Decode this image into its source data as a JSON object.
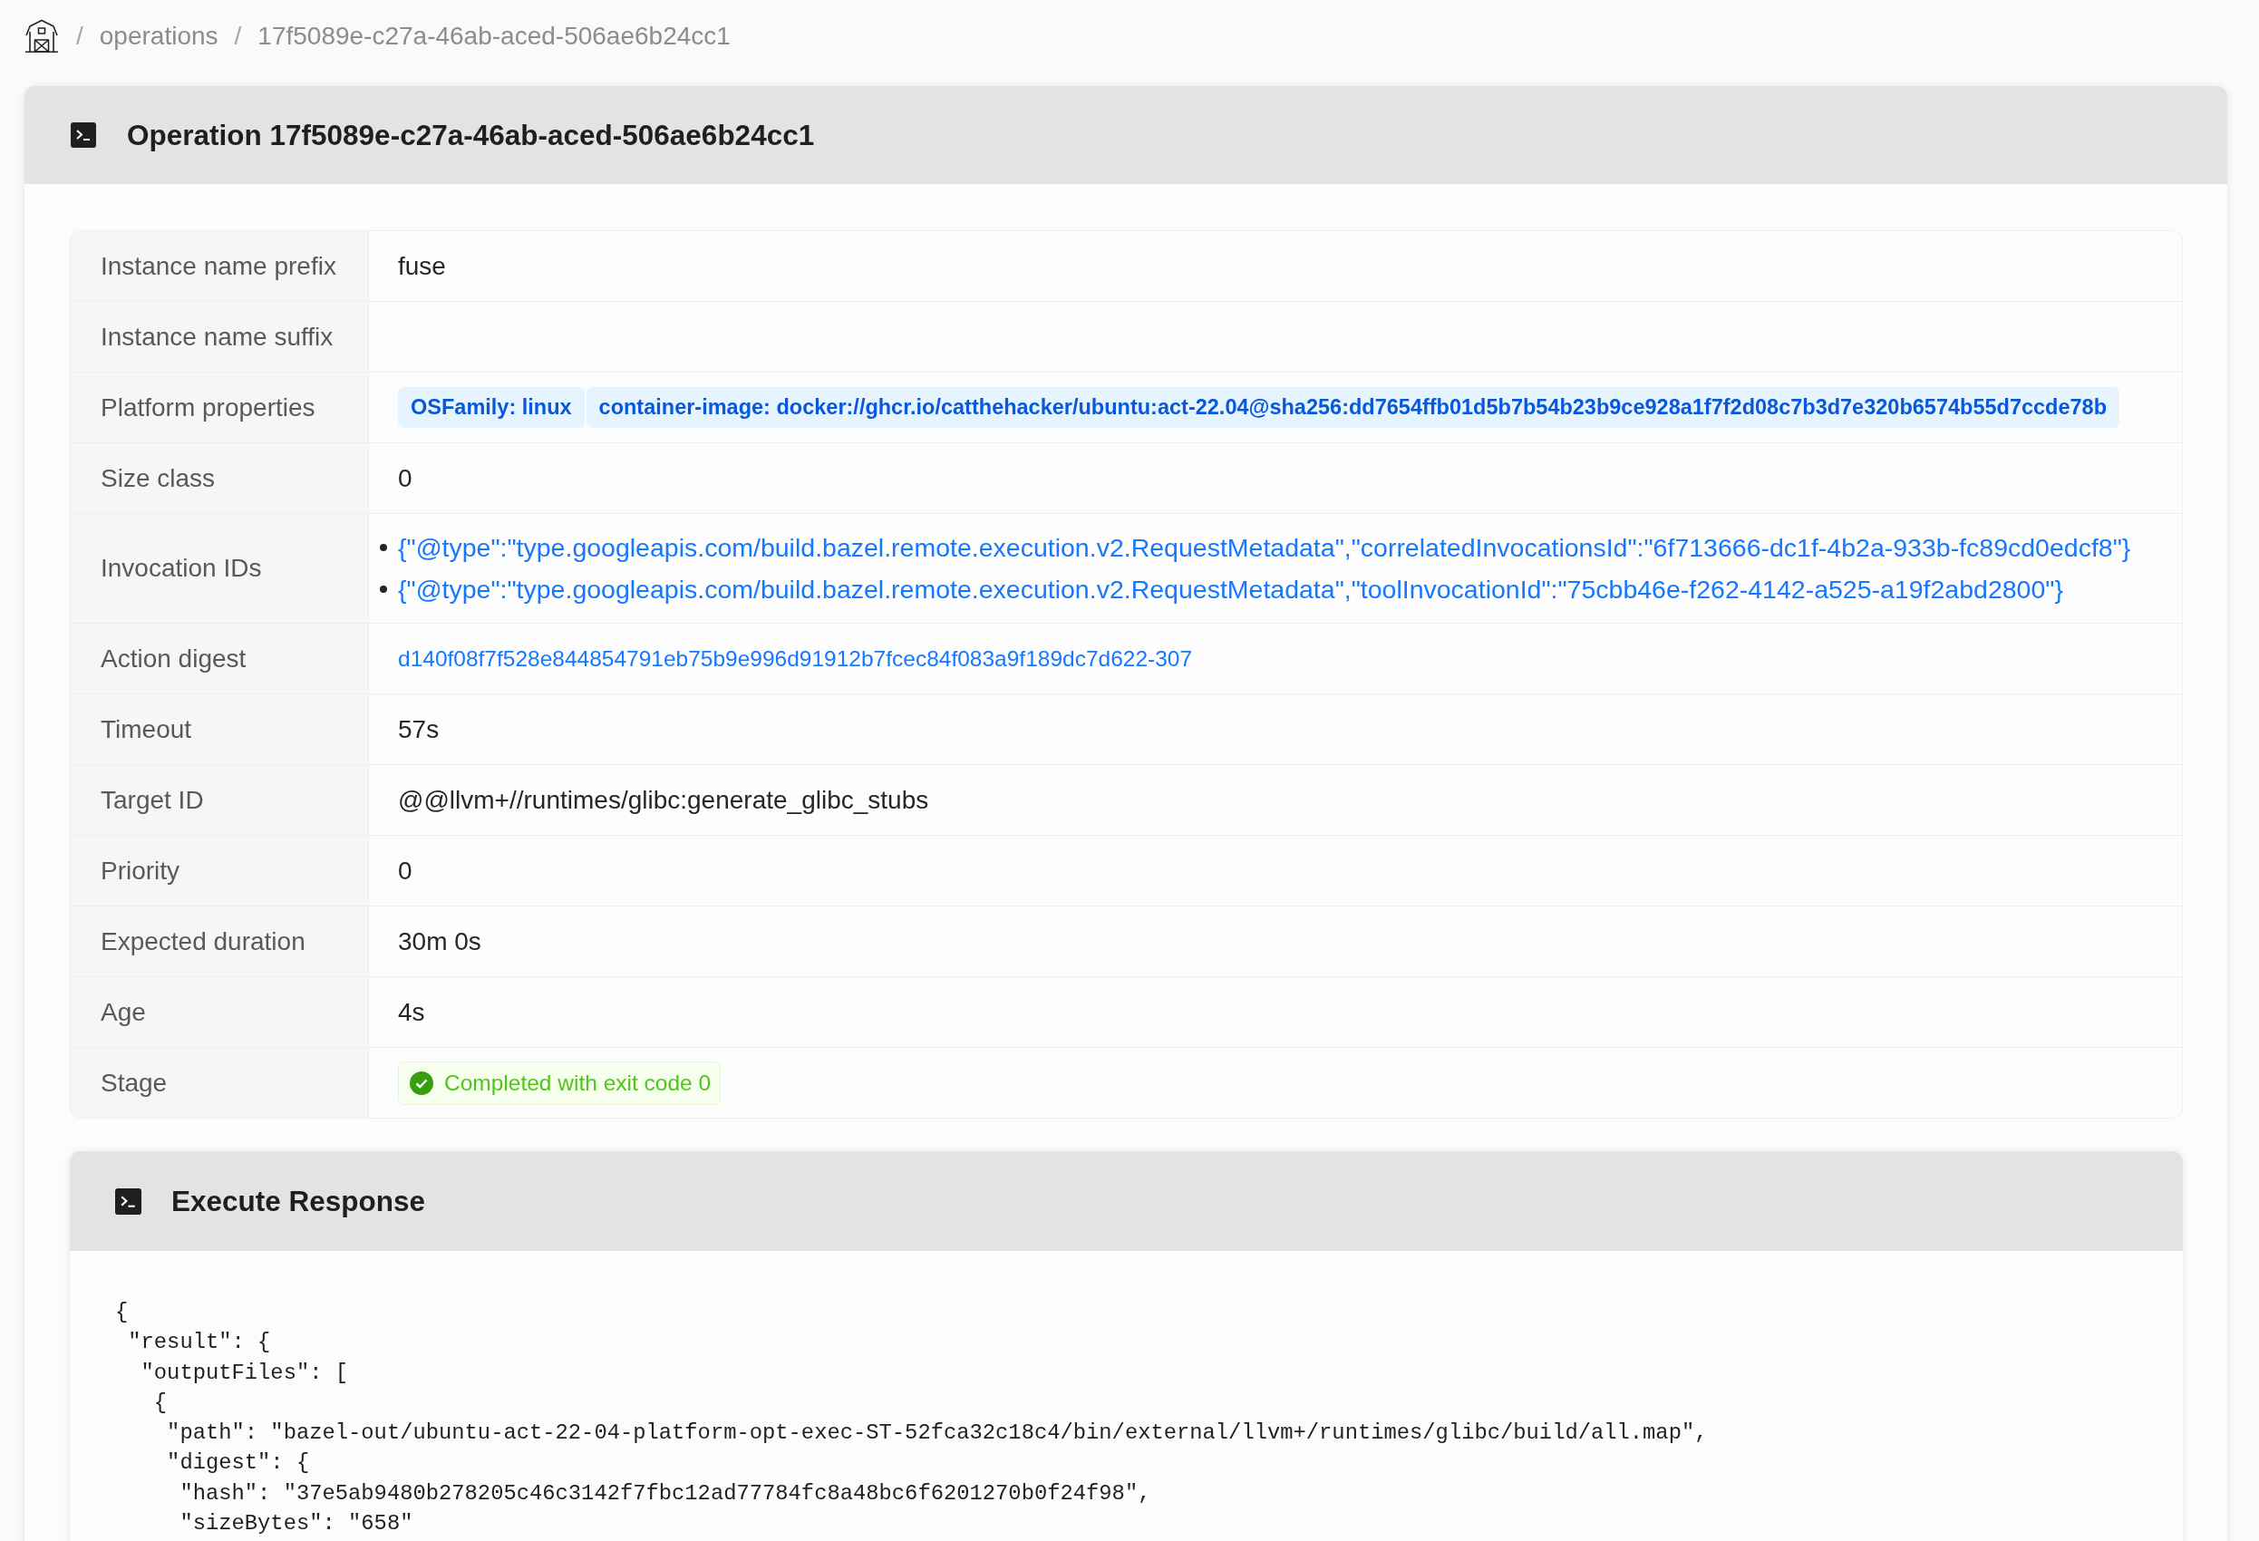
{
  "breadcrumb": [
    {
      "separator": "/",
      "label": "operations"
    },
    {
      "separator": "/",
      "label": "17f5089e-c27a-46ab-aced-506ae6b24cc1"
    }
  ],
  "operation": {
    "title": "Operation 17f5089e-c27a-46ab-aced-506ae6b24cc1",
    "details": [
      {
        "label": "Instance name prefix",
        "kind": "text",
        "value": "fuse"
      },
      {
        "label": "Instance name suffix",
        "kind": "text"
      },
      {
        "label": "Platform properties",
        "kind": "tags",
        "tags": [
          "OSFamily: linux",
          "container-image: docker://ghcr.io/catthehacker/ubuntu:act-22.04@sha256:dd7654ffb01d5b7b54b23b9ce928a1f7f2d08c7b3d7e320b6574b55d7ccde78b"
        ]
      },
      {
        "label": "Size class",
        "kind": "text",
        "value": "0"
      },
      {
        "label": "Invocation IDs",
        "kind": "list",
        "items": [
          "{\"@type\":\"type.googleapis.com/build.bazel.remote.execution.v2.RequestMetadata\",\"correlatedInvocationsId\":\"6f713666-dc1f-4b2a-933b-fc89cd0edcf8\"}",
          "{\"@type\":\"type.googleapis.com/build.bazel.remote.execution.v2.RequestMetadata\",\"toolInvocationId\":\"75cbb46e-f262-4142-a525-a19f2abd2800\"}"
        ]
      },
      {
        "label": "Action digest",
        "kind": "link",
        "value": "d140f08f7f528e844854791eb75b9e996d91912b7fcec84f083a9f189dc7d622-307"
      },
      {
        "label": "Timeout",
        "kind": "text",
        "value": "57s"
      },
      {
        "label": "Target ID",
        "kind": "text",
        "value": "@@llvm+//runtimes/glibc:generate_glibc_stubs"
      },
      {
        "label": "Priority",
        "kind": "text",
        "value": "0"
      },
      {
        "label": "Expected duration",
        "kind": "text",
        "value": "30m 0s"
      },
      {
        "label": "Age",
        "kind": "text",
        "value": "4s"
      },
      {
        "label": "Stage",
        "kind": "status",
        "succeeded": true,
        "value": "Completed with exit code 0"
      }
    ]
  },
  "execute_response": {
    "title": "Execute Response",
    "code": "{\n \"result\": {\n  \"outputFiles\": [\n   {\n    \"path\": \"bazel-out/ubuntu-act-22-04-platform-opt-exec-ST-52fca32c18c4/bin/external/llvm+/runtimes/glibc/build/all.map\",\n    \"digest\": {\n     \"hash\": \"37e5ab9480b278205c46c3142f7fbc12ad77784fc8a48bc6f6201270b0f24f98\",\n     \"sizeBytes\": \"658\""
  }
}
